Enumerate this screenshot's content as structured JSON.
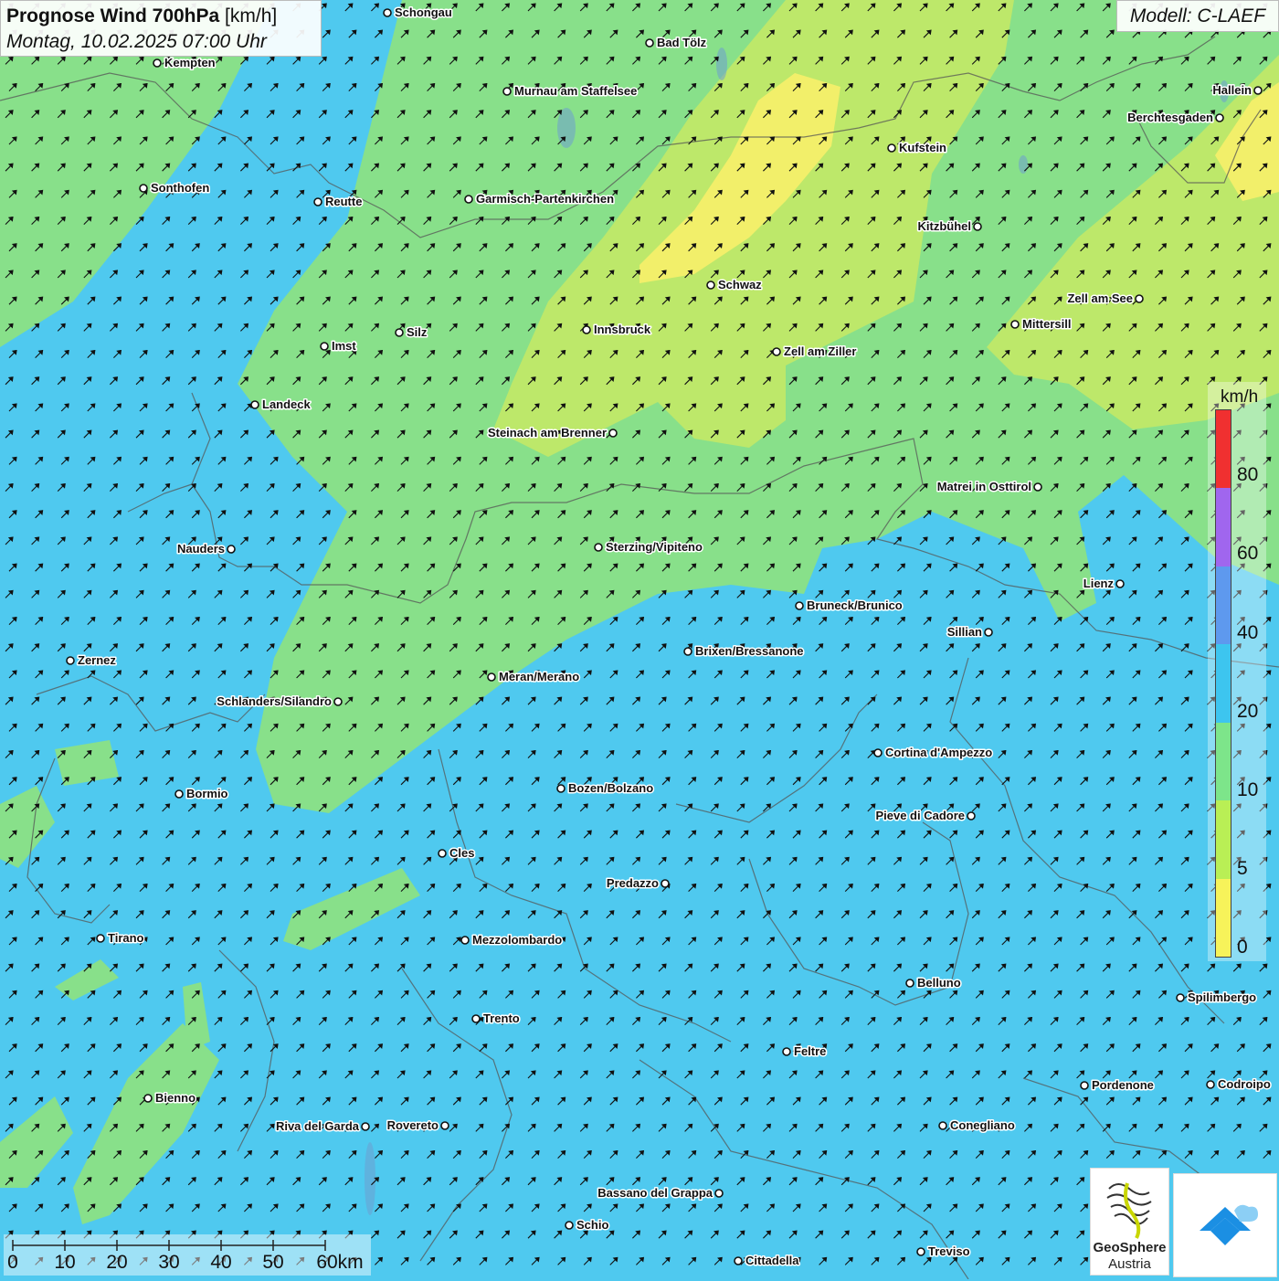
{
  "header": {
    "title_bold": "Prognose Wind 700hPa",
    "title_unit": "[km/h]",
    "datetime": "Montag, 10.02.2025 07:00 Uhr",
    "model": "Modell: C-LAEF"
  },
  "legend": {
    "unit": "km/h",
    "ticks": [
      "80",
      "60",
      "40",
      "20",
      "10",
      "5",
      "0"
    ],
    "colors": [
      "#f03030",
      "#a066ee",
      "#5e99ee",
      "#3dc5ef",
      "#7de58a",
      "#b9ef55",
      "#f7f35a"
    ]
  },
  "scalebar": {
    "labels": [
      "0",
      "10",
      "20",
      "30",
      "40",
      "50",
      "60km"
    ]
  },
  "cities": [
    {
      "name": "Schongau"
    },
    {
      "name": "Bad Tölz"
    },
    {
      "name": "Kempten"
    },
    {
      "name": "Murnau am Staffelsee"
    },
    {
      "name": "Hallein"
    },
    {
      "name": "Berchtesgaden"
    },
    {
      "name": "Kufstein"
    },
    {
      "name": "Sonthofen"
    },
    {
      "name": "Reutte"
    },
    {
      "name": "Garmisch-Partenkirchen"
    },
    {
      "name": "Kitzbühel"
    },
    {
      "name": "Schwaz"
    },
    {
      "name": "Zell am See"
    },
    {
      "name": "Innsbruck"
    },
    {
      "name": "Mittersill"
    },
    {
      "name": "Imst"
    },
    {
      "name": "Silz"
    },
    {
      "name": "Zell am Ziller"
    },
    {
      "name": "Landeck"
    },
    {
      "name": "Steinach am Brenner"
    },
    {
      "name": "Matrei in Osttirol"
    },
    {
      "name": "Nauders"
    },
    {
      "name": "Sterzing/Vipiteno"
    },
    {
      "name": "Lienz"
    },
    {
      "name": "Bruneck/Brunico"
    },
    {
      "name": "Sillian"
    },
    {
      "name": "Zernez"
    },
    {
      "name": "Brixen/Bressanone"
    },
    {
      "name": "Meran/Merano"
    },
    {
      "name": "Schlanders/Silandro"
    },
    {
      "name": "Cortina d'Ampezzo"
    },
    {
      "name": "Bozen/Bolzano"
    },
    {
      "name": "Bormio"
    },
    {
      "name": "Pieve di Cadore"
    },
    {
      "name": "Cles"
    },
    {
      "name": "Predazzo"
    },
    {
      "name": "Tirano"
    },
    {
      "name": "Mezzolombardo"
    },
    {
      "name": "Belluno"
    },
    {
      "name": "Spilimbergo"
    },
    {
      "name": "Trento"
    },
    {
      "name": "Feltre"
    },
    {
      "name": "Bienno"
    },
    {
      "name": "Pordenone"
    },
    {
      "name": "Codroipo"
    },
    {
      "name": "Riva del Garda"
    },
    {
      "name": "Rovereto"
    },
    {
      "name": "Conegliano"
    },
    {
      "name": "Bassano del Grappa"
    },
    {
      "name": "Schio"
    },
    {
      "name": "Treviso"
    },
    {
      "name": "Cittadella"
    }
  ],
  "logos": {
    "geosphere_line1": "GeoSphere",
    "geosphere_line2": "Austria"
  },
  "colors": {
    "bg_20_40": "#4fc9ef",
    "band_10_20": "#88e08a",
    "band_5_10": "#bde86a",
    "band_0_5": "#f2ef6a",
    "border": "#555555",
    "arrow": "#111111"
  }
}
